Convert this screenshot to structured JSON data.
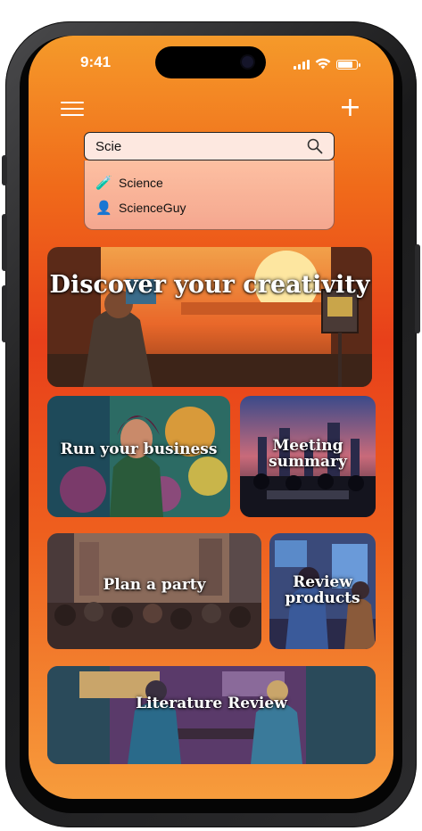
{
  "status_bar": {
    "time": "9:41",
    "battery_level": 0.85,
    "signal_bars": 4
  },
  "toolbar": {
    "menu_icon": "hamburger-icon",
    "add_icon": "plus-icon",
    "add_label": "+"
  },
  "search": {
    "value": "Scie",
    "icon": "search-icon"
  },
  "suggestions": [
    {
      "label": "Science",
      "icon": "test-tube-icon",
      "glyph": "🧪"
    },
    {
      "label": "ScienceGuy",
      "icon": "user-icon",
      "glyph": "👤"
    }
  ],
  "cards": [
    {
      "title": "Discover your creativity"
    },
    {
      "title": "Run your business"
    },
    {
      "title": "Meeting summary"
    },
    {
      "title": "Plan a party"
    },
    {
      "title": "Review products"
    },
    {
      "title": "Literature Review"
    }
  ]
}
